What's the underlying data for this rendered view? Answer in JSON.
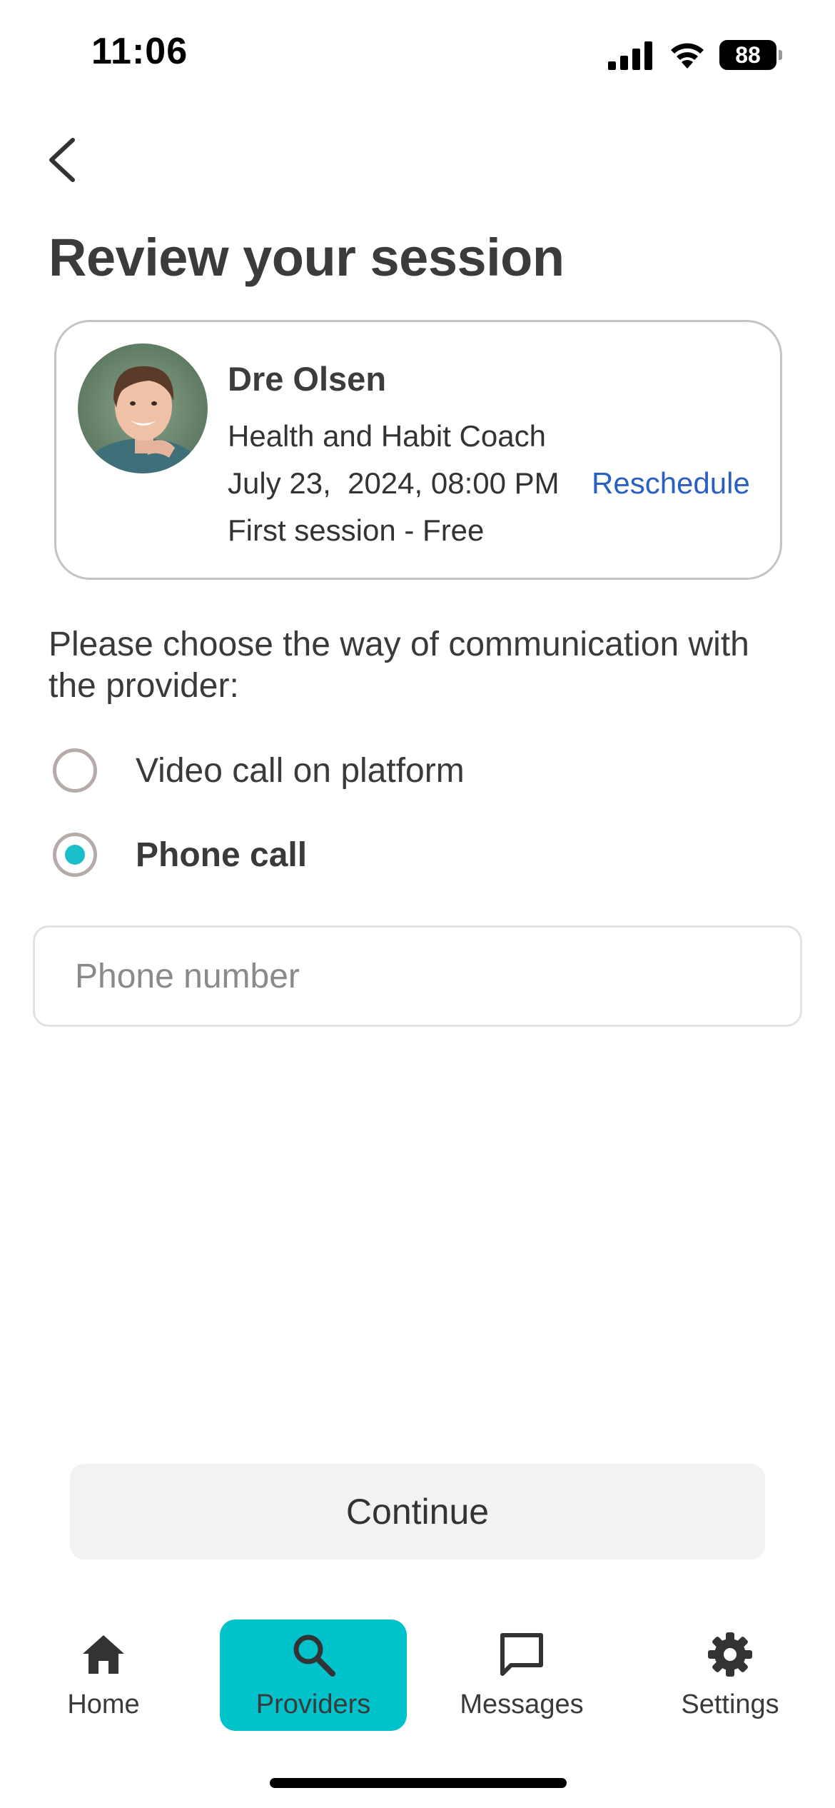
{
  "status_bar": {
    "time": "11:06",
    "battery_level": "88",
    "icons": [
      "signal-icon",
      "wifi-icon",
      "battery-icon"
    ]
  },
  "header": {
    "back_icon": "chevron-left-icon",
    "title": "Review your session"
  },
  "provider": {
    "name": "Dre Olsen",
    "role": "Health and Habit Coach",
    "datetime": "July 23,  2024, 08:00 PM",
    "reschedule_label": "Reschedule",
    "price": "First session - Free"
  },
  "communication": {
    "prompt": "Please choose the way of communication with the provider:",
    "options": [
      {
        "label": "Video call on platform",
        "selected": false
      },
      {
        "label": "Phone call",
        "selected": true
      }
    ],
    "phone_placeholder": "Phone number",
    "phone_value": ""
  },
  "continue_label": "Continue",
  "tab_bar": {
    "items": [
      {
        "label": "Home",
        "icon": "home-icon"
      },
      {
        "label": "Providers",
        "icon": "search-icon",
        "active": true
      },
      {
        "label": "Messages",
        "icon": "message-icon"
      },
      {
        "label": "Settings",
        "icon": "gear-icon"
      }
    ]
  },
  "colors": {
    "accent": "#00c2ca",
    "radio_selected": "#1bbfc9",
    "link": "#2a5fc4",
    "title": "#3b3b3b"
  }
}
